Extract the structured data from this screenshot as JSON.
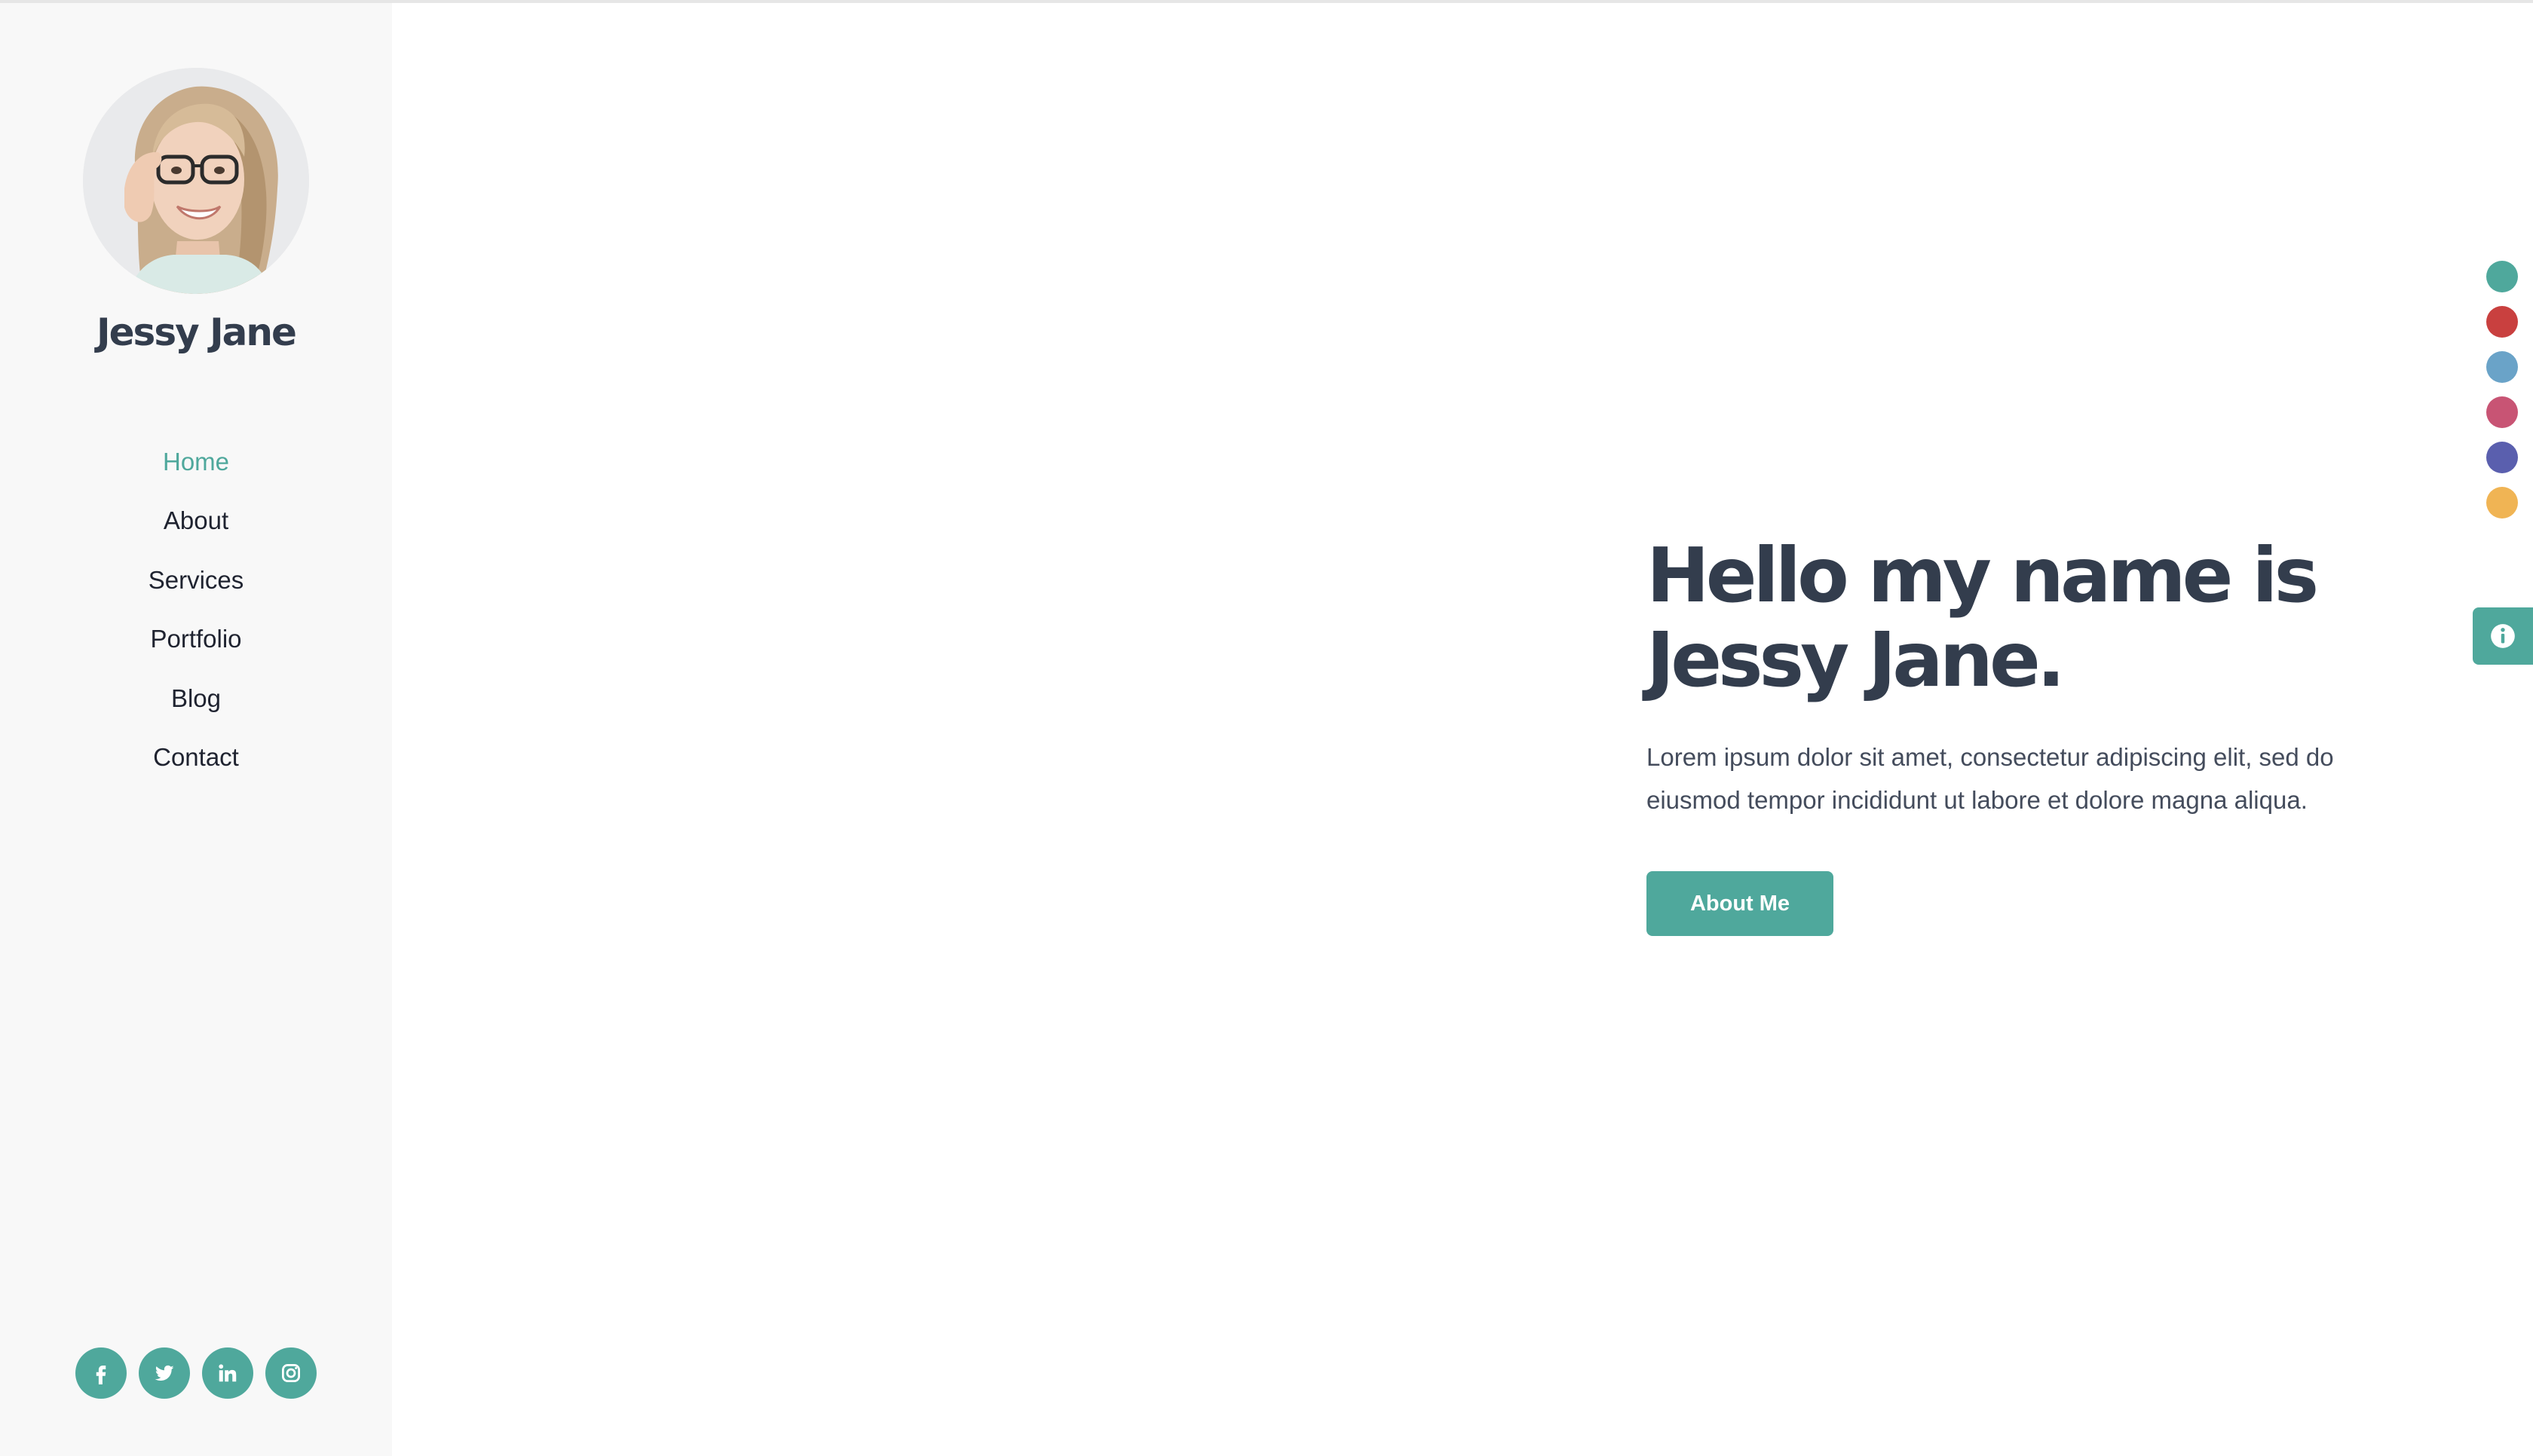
{
  "profile": {
    "name": "Jessy Jane"
  },
  "nav": {
    "items": [
      {
        "label": "Home",
        "active": true
      },
      {
        "label": "About",
        "active": false
      },
      {
        "label": "Services",
        "active": false
      },
      {
        "label": "Portfolio",
        "active": false
      },
      {
        "label": "Blog",
        "active": false
      },
      {
        "label": "Contact",
        "active": false
      }
    ]
  },
  "socials": [
    {
      "icon": "facebook-icon"
    },
    {
      "icon": "twitter-icon"
    },
    {
      "icon": "linkedin-icon"
    },
    {
      "icon": "instagram-icon"
    }
  ],
  "hero": {
    "title_line1": "Hello my name is",
    "title_line2": "Jessy Jane.",
    "description": "Lorem ipsum dolor sit amet, consectetur adipiscing elit, sed do eiusmod tempor incididunt ut labore et dolore magna aliqua.",
    "button_label": "About Me"
  },
  "theme_switcher": {
    "colors": [
      "#4fa89c",
      "#c9403f",
      "#6aa3c8",
      "#c85474",
      "#5a5fae",
      "#f0b454"
    ]
  },
  "info_tab": {
    "icon": "info-icon"
  },
  "colors": {
    "accent": "#4fa89c",
    "heading": "#333d4d",
    "sidebar_bg": "#f8f8f8"
  }
}
